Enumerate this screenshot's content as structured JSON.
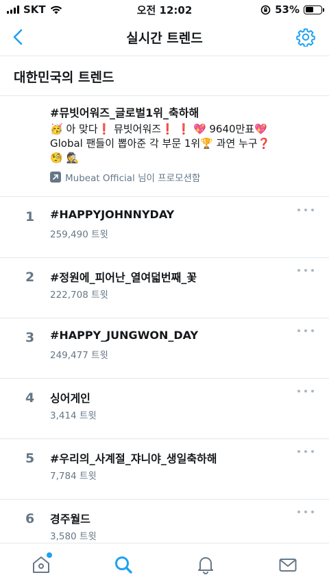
{
  "status_bar": {
    "carrier": "SKT",
    "time": "오전 12:02",
    "battery_text": "53%",
    "battery_level": 0.53
  },
  "nav": {
    "title": "실시간 트렌드",
    "accent_color": "#1da1f2"
  },
  "section": {
    "title": "대한민국의 트렌드"
  },
  "promoted": {
    "title": "#뮤빗어워즈_글로벌1위_축하해",
    "desc_line1": "🥳 아 맞다❗ 뮤빗어워즈❗ ❗ 💖 9640만표💖",
    "desc_line2": "Global 팬들이 뽑아준 각 부문 1위🏆 과연 누구❓",
    "desc_line3": "🧐 🕵",
    "promoter": "Mubeat Official 님이 프로모션함"
  },
  "trends": [
    {
      "rank": "1",
      "name": "#HAPPYJOHNNYDAY",
      "count": "259,490 트윗"
    },
    {
      "rank": "2",
      "name": "#정원에_피어난_열여덟번째_꽃",
      "count": "222,708 트윗"
    },
    {
      "rank": "3",
      "name": "#HAPPY_JUNGWON_DAY",
      "count": "249,477 트윗"
    },
    {
      "rank": "4",
      "name": "싱어게인",
      "count": "3,414 트윗"
    },
    {
      "rank": "5",
      "name": "#우리의_사계절_쟈니야_생일축하해",
      "count": "7,784 트윗"
    },
    {
      "rank": "6",
      "name": "경주월드",
      "count": "3,580 트윗"
    }
  ],
  "tab_bar": {
    "tabs": [
      "home-icon",
      "search-icon",
      "notifications-icon",
      "messages-icon"
    ],
    "active": "search-icon"
  }
}
